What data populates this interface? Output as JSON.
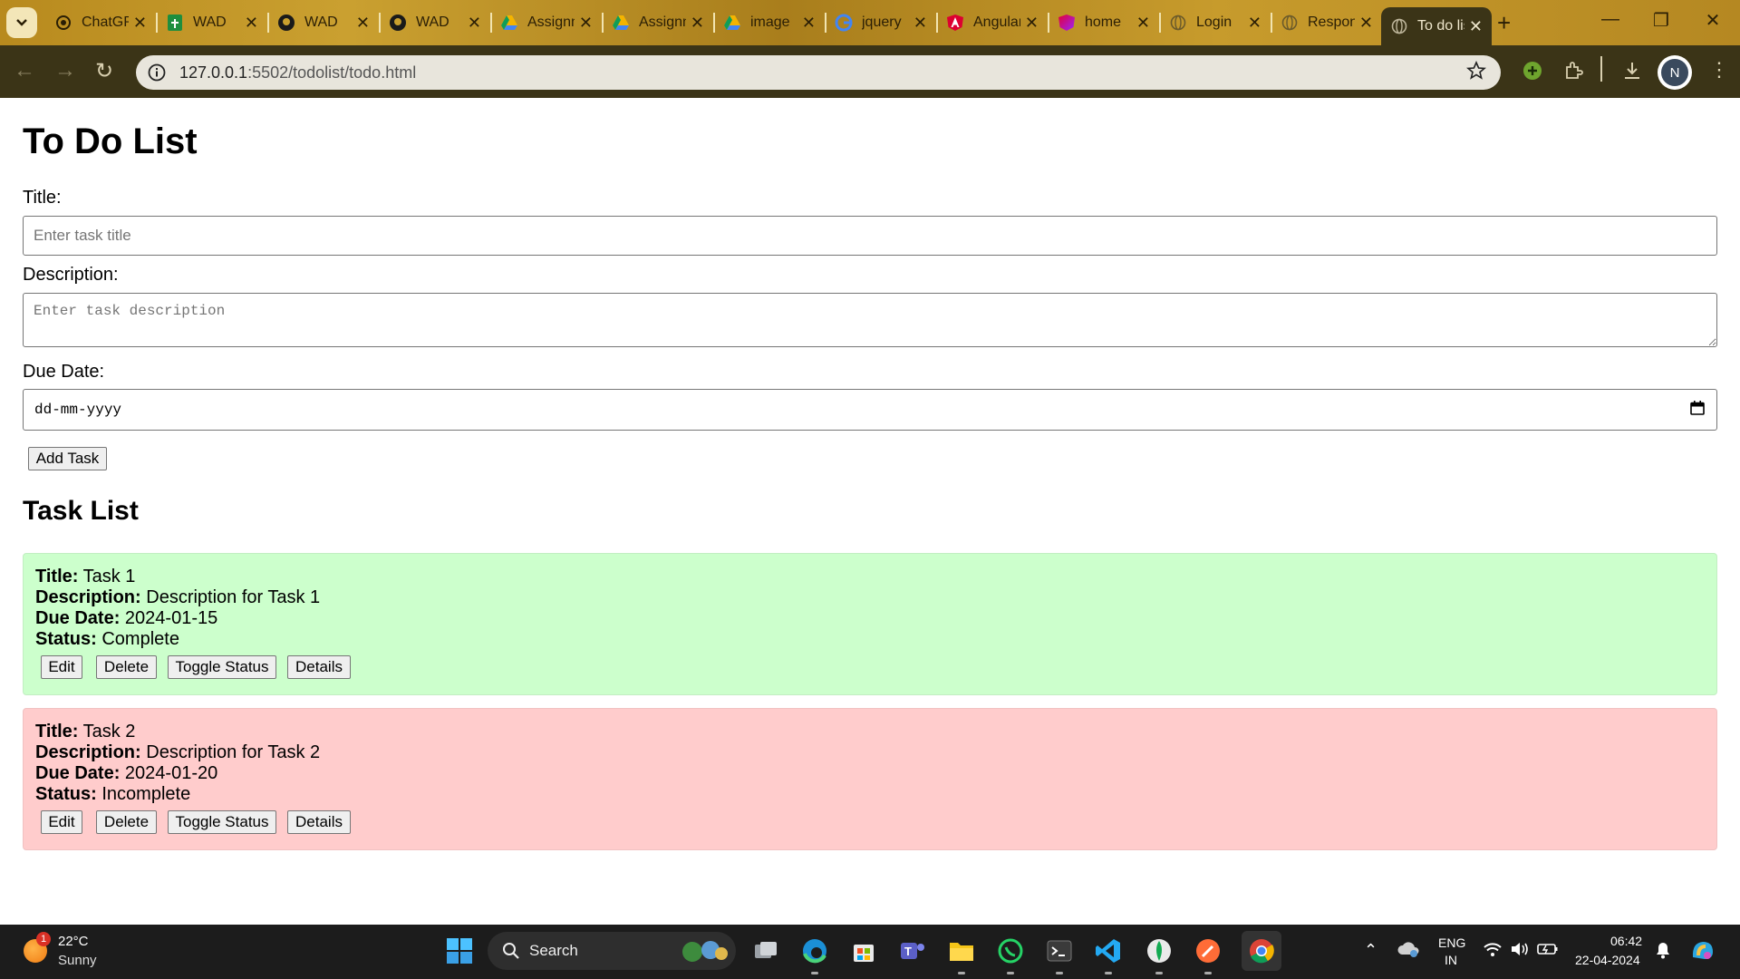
{
  "browser": {
    "tabs": [
      {
        "label": "ChatGPT",
        "icon": "chatgpt-icon"
      },
      {
        "label": "WAD",
        "icon": "sheets-icon"
      },
      {
        "label": "WAD",
        "icon": "github-icon"
      },
      {
        "label": "WAD",
        "icon": "github-icon"
      },
      {
        "label": "Assignment",
        "icon": "drive-icon"
      },
      {
        "label": "Assignment",
        "icon": "drive-icon"
      },
      {
        "label": "image",
        "icon": "drive-icon"
      },
      {
        "label": "jquery",
        "icon": "google-icon"
      },
      {
        "label": "Angular",
        "icon": "angular-icon"
      },
      {
        "label": "home",
        "icon": "angular-gradient-icon"
      },
      {
        "label": "Login",
        "icon": "globe-icon"
      },
      {
        "label": "Responsive",
        "icon": "globe-icon"
      },
      {
        "label": "To do list",
        "icon": "globe-icon"
      }
    ],
    "url_host": "127.0.0.1",
    "url_path": ":5502/todolist/todo.html",
    "profile_initial": "N"
  },
  "page": {
    "title": "To Do List",
    "form": {
      "title_label": "Title:",
      "title_placeholder": "Enter task title",
      "description_label": "Description:",
      "description_placeholder": "Enter task description",
      "due_label": "Due Date:",
      "due_placeholder": "dd-mm-yyyy",
      "add_button": "Add Task"
    },
    "task_list_heading": "Task List",
    "field_labels": {
      "title": "Title:",
      "description": "Description:",
      "due": "Due Date:",
      "status": "Status:"
    },
    "actions": {
      "edit": "Edit",
      "delete": "Delete",
      "toggle": "Toggle Status",
      "details": "Details"
    },
    "tasks": [
      {
        "title": "Task 1",
        "description": "Description for Task 1",
        "due": "2024-01-15",
        "status": "Complete"
      },
      {
        "title": "Task 2",
        "description": "Description for Task 2",
        "due": "2024-01-20",
        "status": "Incomplete"
      }
    ]
  },
  "taskbar": {
    "weather_temp": "22°C",
    "weather_desc": "Sunny",
    "weather_badge": "1",
    "search_label": "Search",
    "lang_top": "ENG",
    "lang_bottom": "IN",
    "time": "06:42",
    "date": "22-04-2024"
  },
  "colors": {
    "complete_bg": "#ccffcc",
    "incomplete_bg": "#ffcccc",
    "toolbar_bg": "#3b3417"
  }
}
